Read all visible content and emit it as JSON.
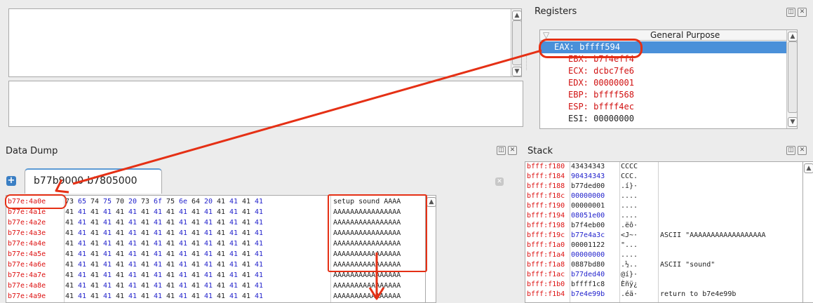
{
  "registers": {
    "title": "Registers",
    "group": "General Purpose",
    "rows": [
      {
        "text": "EAX: bffff594",
        "selected": true,
        "color": "#ffffff"
      },
      {
        "text": "EBX: b7f4eff4",
        "selected": false,
        "color": "#d11111"
      },
      {
        "text": "ECX: dcbc7fe6",
        "selected": false,
        "color": "#d11111"
      },
      {
        "text": "EDX: 00000001",
        "selected": false,
        "color": "#d11111"
      },
      {
        "text": "EBP: bffff568",
        "selected": false,
        "color": "#d11111"
      },
      {
        "text": "ESP: bffff4ec",
        "selected": false,
        "color": "#d11111"
      },
      {
        "text": "ESI: 00000000",
        "selected": false,
        "color": "#222222"
      }
    ]
  },
  "data_dump": {
    "title": "Data Dump",
    "tab_label": "b77b9000-b7805000",
    "rows": [
      {
        "addr": "b77e:4a0e",
        "bytes": [
          "73",
          "65",
          "74",
          "75",
          "70",
          "20",
          "73",
          "6f",
          "75",
          "6e",
          "64",
          "20",
          "41",
          "41",
          "41",
          "41"
        ],
        "ascii": "setup sound AAAA"
      },
      {
        "addr": "b77e:4a1e",
        "bytes": [
          "41",
          "41",
          "41",
          "41",
          "41",
          "41",
          "41",
          "41",
          "41",
          "41",
          "41",
          "41",
          "41",
          "41",
          "41",
          "41"
        ],
        "ascii": "AAAAAAAAAAAAAAAA"
      },
      {
        "addr": "b77e:4a2e",
        "bytes": [
          "41",
          "41",
          "41",
          "41",
          "41",
          "41",
          "41",
          "41",
          "41",
          "41",
          "41",
          "41",
          "41",
          "41",
          "41",
          "41"
        ],
        "ascii": "AAAAAAAAAAAAAAAA"
      },
      {
        "addr": "b77e:4a3e",
        "bytes": [
          "41",
          "41",
          "41",
          "41",
          "41",
          "41",
          "41",
          "41",
          "41",
          "41",
          "41",
          "41",
          "41",
          "41",
          "41",
          "41"
        ],
        "ascii": "AAAAAAAAAAAAAAAA"
      },
      {
        "addr": "b77e:4a4e",
        "bytes": [
          "41",
          "41",
          "41",
          "41",
          "41",
          "41",
          "41",
          "41",
          "41",
          "41",
          "41",
          "41",
          "41",
          "41",
          "41",
          "41"
        ],
        "ascii": "AAAAAAAAAAAAAAAA"
      },
      {
        "addr": "b77e:4a5e",
        "bytes": [
          "41",
          "41",
          "41",
          "41",
          "41",
          "41",
          "41",
          "41",
          "41",
          "41",
          "41",
          "41",
          "41",
          "41",
          "41",
          "41"
        ],
        "ascii": "AAAAAAAAAAAAAAAA"
      },
      {
        "addr": "b77e:4a6e",
        "bytes": [
          "41",
          "41",
          "41",
          "41",
          "41",
          "41",
          "41",
          "41",
          "41",
          "41",
          "41",
          "41",
          "41",
          "41",
          "41",
          "41"
        ],
        "ascii": "AAAAAAAAAAAAAAAA"
      },
      {
        "addr": "b77e:4a7e",
        "bytes": [
          "41",
          "41",
          "41",
          "41",
          "41",
          "41",
          "41",
          "41",
          "41",
          "41",
          "41",
          "41",
          "41",
          "41",
          "41",
          "41"
        ],
        "ascii": "AAAAAAAAAAAAAAAA"
      },
      {
        "addr": "b77e:4a8e",
        "bytes": [
          "41",
          "41",
          "41",
          "41",
          "41",
          "41",
          "41",
          "41",
          "41",
          "41",
          "41",
          "41",
          "41",
          "41",
          "41",
          "41"
        ],
        "ascii": "AAAAAAAAAAAAAAAA"
      },
      {
        "addr": "b77e:4a9e",
        "bytes": [
          "41",
          "41",
          "41",
          "41",
          "41",
          "41",
          "41",
          "41",
          "41",
          "41",
          "41",
          "41",
          "41",
          "41",
          "41",
          "41"
        ],
        "ascii": "AAAAAAAAAAAAAAAA"
      }
    ]
  },
  "stack": {
    "title": "Stack",
    "rows": [
      {
        "addr": "bfff:f180",
        "value": "43434343",
        "blue": false,
        "ascii": "CCCC",
        "comment": ""
      },
      {
        "addr": "bfff:f184",
        "value": "90434343",
        "blue": true,
        "ascii": "CCC.",
        "comment": ""
      },
      {
        "addr": "bfff:f188",
        "value": "b77ded00",
        "blue": false,
        "ascii": ".í}·",
        "comment": ""
      },
      {
        "addr": "bfff:f18c",
        "value": "00000000",
        "blue": true,
        "ascii": "....",
        "comment": ""
      },
      {
        "addr": "bfff:f190",
        "value": "00000001",
        "blue": false,
        "ascii": "....",
        "comment": ""
      },
      {
        "addr": "bfff:f194",
        "value": "08051e00",
        "blue": true,
        "ascii": "....",
        "comment": ""
      },
      {
        "addr": "bfff:f198",
        "value": "b7f4eb00",
        "blue": false,
        "ascii": ".ëô·",
        "comment": ""
      },
      {
        "addr": "bfff:f19c",
        "value": "b77e4a3c",
        "blue": true,
        "ascii": "<J~·",
        "comment": "ASCII \"AAAAAAAAAAAAAAAAAA"
      },
      {
        "addr": "bfff:f1a0",
        "value": "00001122",
        "blue": false,
        "ascii": "\"...",
        "comment": ""
      },
      {
        "addr": "bfff:f1a4",
        "value": "00000000",
        "blue": true,
        "ascii": "....",
        "comment": ""
      },
      {
        "addr": "bfff:f1a8",
        "value": "0887bd80",
        "blue": false,
        "ascii": ".½..",
        "comment": "ASCII \"sound\""
      },
      {
        "addr": "bfff:f1ac",
        "value": "b77ded40",
        "blue": true,
        "ascii": "@í}·",
        "comment": ""
      },
      {
        "addr": "bfff:f1b0",
        "value": "bffff1c8",
        "blue": false,
        "ascii": "Èñÿ¿",
        "comment": ""
      },
      {
        "addr": "bfff:f1b4",
        "value": "b7e4e99b",
        "blue": true,
        "ascii": ".éä·",
        "comment": "return to b7e4e99b"
      }
    ]
  },
  "icons": {
    "dock_float": "float-icon",
    "dock_close": "close-icon",
    "add_tab": "add-tab-icon",
    "close_tab": "close-tab-icon"
  },
  "colors": {
    "annotation": "#e53015",
    "selection": "#4a90d9",
    "address_red": "#d11111",
    "value_blue": "#2222cc"
  }
}
